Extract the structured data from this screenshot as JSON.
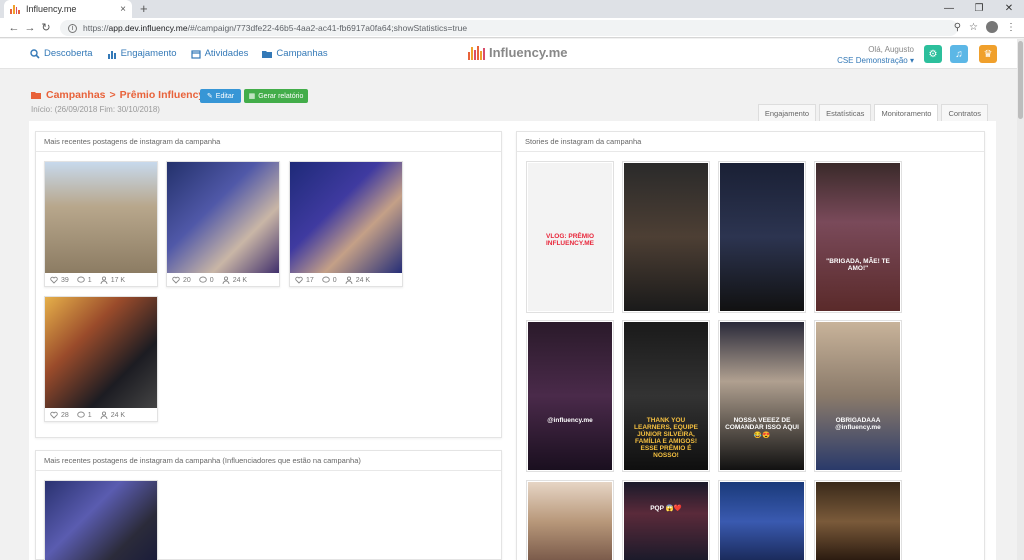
{
  "browser": {
    "tab_title": "Influency.me",
    "tab_close": "×",
    "new_tab": "+",
    "url_scheme": "https://",
    "url_domain": "app.dev.influency.me",
    "url_path": "/#/campaign/773dfe22-46b5-4aa2-ac41-fb6917a0fa64;showStatistics=true"
  },
  "nav": {
    "items": [
      {
        "label": "Descoberta",
        "icon": "search-icon"
      },
      {
        "label": "Engajamento",
        "icon": "chart-icon"
      },
      {
        "label": "Atividades",
        "icon": "calendar-icon"
      },
      {
        "label": "Campanhas",
        "icon": "folder-icon"
      }
    ]
  },
  "logo": {
    "text": "Influency.me",
    "bar_colors": [
      "#e8623a",
      "#f0a02c",
      "#d94d6a",
      "#e8623a",
      "#f0a02c",
      "#d94d6a"
    ]
  },
  "user": {
    "greeting": "Olá, Augusto",
    "org": "CSE Demonstração ▾"
  },
  "header_buttons": [
    {
      "icon": "gear-icon",
      "color": "#2cbf9c"
    },
    {
      "icon": "bell-icon",
      "color": "#5cb7e6"
    },
    {
      "icon": "trophy-icon",
      "color": "#f0a02c"
    }
  ],
  "campaign": {
    "breadcrumb_root": "Campanhas",
    "breadcrumb_sep": ">",
    "name": "Prêmio Influency.me",
    "edit_label": "Editar",
    "report_label": "Gerar relatório",
    "dates": "Início: (26/09/2018 Fim: 30/10/2018)"
  },
  "tabs": [
    {
      "label": "Engajamento",
      "active": false
    },
    {
      "label": "Estatísticas",
      "active": false
    },
    {
      "label": "Monitoramento",
      "active": true
    },
    {
      "label": "Contratos",
      "active": false
    }
  ],
  "panels": {
    "recent_posts_title": "Mais recentes postagens de instagram da campanha",
    "stories_title": "Stories de instagram da campanha",
    "influencer_posts_title": "Mais recentes postagens de instagram da campanha (Influenciadores que estão na campanha)"
  },
  "posts": [
    {
      "likes": "39",
      "comments": "1",
      "reach": "17 K",
      "bg": "linear-gradient(180deg,#c7d9ec 0%,#b8a78c 40%,#8c7c63 100%)"
    },
    {
      "likes": "20",
      "comments": "0",
      "reach": "24 K",
      "bg": "linear-gradient(135deg,#23316b 0%,#5058a8 40%,#c9b6a6 70%,#41306c 100%)"
    },
    {
      "likes": "17",
      "comments": "0",
      "reach": "24 K",
      "bg": "linear-gradient(135deg,#1e2a78 0%,#3f3aa0 40%,#c4a087 65%,#262e78 100%)"
    },
    {
      "likes": "28",
      "comments": "1",
      "reach": "24 K",
      "bg": "linear-gradient(135deg,#e6b04a 0%,#9a4b2b 35%,#1c1c22 70%,#444 100%)"
    }
  ],
  "influencer_post": {
    "bg": "linear-gradient(135deg,#2a3270 0%,#5a5cb0 40%,#2b2b3a 75%,#1b1d3a 100%)"
  },
  "stories": [
    {
      "bg": "#f3f3f3",
      "text": "VLOG: PRÊMIO INFLUENCY.ME",
      "text_color": "#e8263a"
    },
    {
      "bg": "linear-gradient(180deg,#2a2a2a,#4d3f34 50%,#1a1a1a)",
      "text": "",
      "text_color": "#fff"
    },
    {
      "bg": "linear-gradient(180deg,#1a2035,#2c3450 50%,#111)",
      "text": "",
      "text_color": "#fff"
    },
    {
      "bg": "linear-gradient(180deg,#3a2a2a,#7a4a5a 40%,#5a2a2a)",
      "text": "\"BRIGADA, MÃE! TE AMO!\"",
      "text_color": "#fff"
    },
    {
      "bg": "linear-gradient(180deg,#2a1a2a,#4a2a4a 50%,#1a0f1f)",
      "text": "@influency.me",
      "text_color": "#fff"
    },
    {
      "bg": "linear-gradient(180deg,#1a1a1a,#333 50%,#0f0f0f)",
      "text": "THANK YOU LEARNERS, EQUIPE JÚNIOR SILVEIRA, FAMÍLIA E AMIGOS! ESSE PRÊMIO É NOSSO!",
      "text_color": "#f5c040"
    },
    {
      "bg": "linear-gradient(180deg,#2a2a3a,#b0a090 40%,#111)",
      "text": "NOSSA VEEEZ DE COMANDAR ISSO AQUI 😂😍",
      "text_color": "#fff"
    },
    {
      "bg": "linear-gradient(180deg,#c8b39a,#8a7a6a 50%,#2a3a6a)",
      "text": "OBRIGADAAA @influency.me",
      "text_color": "#fff"
    },
    {
      "bg": "linear-gradient(180deg,#e6d5c5,#b8987a 50%,#7a5a4a)",
      "text": "",
      "text_color": "#fff"
    },
    {
      "bg": "linear-gradient(180deg,#1a1a2a,#5a2a3a 40%,#1a1a2a)",
      "text": "PQP 😱❤️",
      "text_color": "#fff"
    },
    {
      "bg": "linear-gradient(180deg,#1a3a7a,#3a5ab0 50%,#1a2a5a)",
      "text": "",
      "text_color": "#fff"
    },
    {
      "bg": "linear-gradient(180deg,#3a2a1a,#7a5a3a 50%,#2a1a0f)",
      "text": "",
      "text_color": "#fff"
    }
  ]
}
